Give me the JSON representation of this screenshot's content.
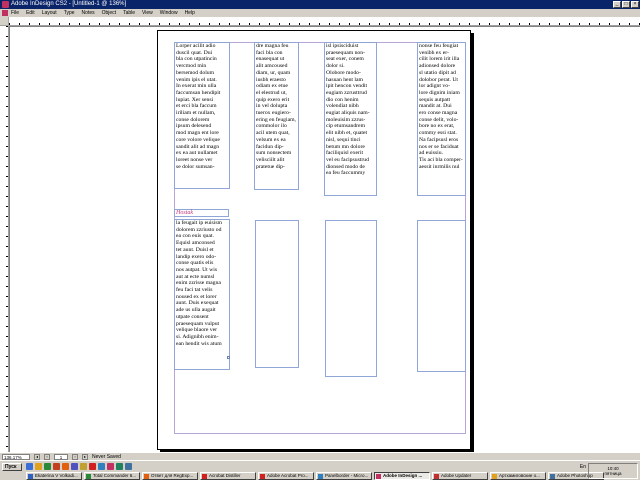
{
  "window": {
    "title": "Adobe InDesign CS2 - [Untitled-1 @ 136%]",
    "buttons": [
      "_",
      "□",
      "×"
    ]
  },
  "menu": [
    "File",
    "Edit",
    "Layout",
    "Type",
    "Notes",
    "Object",
    "Table",
    "View",
    "Window",
    "Help"
  ],
  "document": {
    "frames": [
      {
        "text": "Lorper acilit adio\nduscil quat. Dui\nbla con utpatincin\nvercmod min\nbersemod dolum\nvenim ipis el utat.\nIn exerat min ulla\nfaccumsan hendipit\nlupiat. Xer sensi\net erci bla faccum\niriliam et nullam,\nconse dolorem\nipsum delesend\nmod magn ent lore\ncore volore velique\nsandit alit ad magn\nex ea aut nullamet\nloreet nonse ver\nse dolor sumsan-"
      },
      {
        "text": "dre magna feu\nfaci bla con\nenasequat ut\nalit amcoused\ndiam, ur, quam\niusbh eraesto\nodiam ex etue\nel elestrud ut,\nquip exero erit\nin vel dolupta\ntuerox eugiero-\nering en feugiam,\ncommolor ilo\nacil utem quat,\nvelsum ex ea\nfacidun dip-\nsum nonsectem\nvelisciilt alit\npratetue dip-"
      },
      {
        "text": "isl ipsisciduist\npraesequam non-\nseat exer, conem\ndolor si.\nOlobore modo-\nhasuan hent lam\nipit hencon vendit\neugiam zzrusttrud\ndio con henim\nvolendiat nibh\neugiat aliquis nam-\nmoleuisim zzrus-\ncip etumsandrem\nelit nibh et, quatet\nnisl, sequi tinci\nbetum mn dolore\nfaciliquisl exerit\nvel eu facipsustrud\ndionsed modo de\nea feu faccummy"
      },
      {
        "text": "nonse feu feugiat\nvenibh ex er-\ncilit lorem irit illa\nadionsed dolore\nsl utatio dipit ad\ndolobor perat. Ut\nlor adignt vo-\nlore dignim iniam\nsequis autpatt\nmandit at. Dui\nero conse magna\nconse delit, volo-\nbore no ex erat,\ncommy essi stat.\nNa facipsusl eros\nnos er se faciduat\nad euissiu.\nTis aci bla comper-\naessit inrmilis nul"
      },
      {
        "text": "la feugait ip euisism\ndolorem zzriusto od\nea con euis quat.\nEquisl amconsed\ntet aunt. Duisl et\nlandip exero odo-\nconse quatis elis\nnos autpat. Ut wis\naut at ecte numsl\nenim zzrisse magna\nfeu faci tat velis\nnoused ex et lorer\naunt. Duis exequat\nade us ulla augait\nutpate consent\npraesequam vulput\nvelique blaore ver\nsi. Adignibh enim-\nean hendit wis atum"
      }
    ],
    "heading": "Hostak"
  },
  "statusbar": {
    "zoom": "136.17%",
    "page": "1",
    "label": "Never Saved"
  },
  "taskbar": {
    "start": "Пуск",
    "tasks": [
      "Ekaterina V Volkadi...",
      "Total Commander 6...",
      "Ответ для RegExp...",
      "Acrobat Distiller",
      "Adobe Acrobat Pro...",
      "Panelborder - Micro...",
      "Adobe InDesign ...",
      "Adobe Updater",
      "Артхамиговские о...",
      "Adobe Photoshop"
    ],
    "lang": "En",
    "time": "10:40",
    "day": "пятница"
  },
  "colors": {
    "title_bg": "#0a246a",
    "frame_border": "#8fa6d6",
    "heading": "#c0357a",
    "margin_guide": "#b6a6d8"
  }
}
